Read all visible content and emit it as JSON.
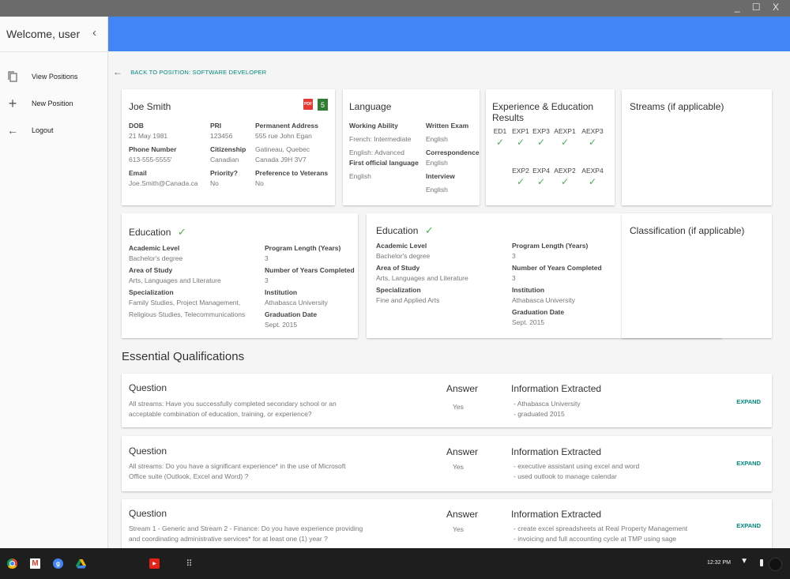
{
  "window": {
    "controls": "_ ☐ X"
  },
  "sidebar": {
    "welcome": "Welcome, user",
    "items": [
      {
        "label": "View Positions",
        "icon": "copy-icon"
      },
      {
        "label": "New Position",
        "icon": "plus-icon"
      },
      {
        "label": "Logout",
        "icon": "arrow-left-icon"
      }
    ]
  },
  "back_link": "BACK TO POSITION: SOFTWARE DEVELOPER",
  "candidate": {
    "name": "Joe Smith",
    "pdf_badge": "PDF",
    "score_badge": "5",
    "col1": [
      {
        "label": "DOB",
        "value": "21 May 1981"
      },
      {
        "label": "Phone Number",
        "value": "613-555-5555'"
      },
      {
        "label": "Email",
        "value": "Joe.Smith@Canada.ca"
      }
    ],
    "col2": [
      {
        "label": "PRI",
        "value": "123456"
      },
      {
        "label": "Citizenship",
        "value": "Canadian"
      },
      {
        "label": "Priority?",
        "value": "No"
      }
    ],
    "col3": {
      "address_label": "Permanent Address",
      "address_lines": [
        "555 rue John Egan",
        "Gatineau, Quebec",
        "Canada J9H 3V7"
      ],
      "veterans_label": "Preference to Veterans",
      "veterans_value": "No"
    }
  },
  "language": {
    "title": "Language",
    "working_label": "Working Ability",
    "french": "French: Intermediate",
    "english": "English: Advanced",
    "first_label": "First official language",
    "first_value": "English",
    "exam_label": "Written Exam",
    "exam_value": "English",
    "corr_label": "Correspondence",
    "corr_value": "English",
    "interview_label": "Interview",
    "interview_value": "English"
  },
  "experience": {
    "title": "Experience & Education Results",
    "row1": [
      "ED1",
      "EXP1",
      "EXP3",
      "AEXP1",
      "AEXP3"
    ],
    "row2": [
      "EXP2",
      "EXP4",
      "AEXP2",
      "AEXP4"
    ],
    "check": "✓"
  },
  "streams": {
    "title": "Streams (if applicable)"
  },
  "classification": {
    "title": "Classification (if applicable)"
  },
  "education": [
    {
      "title": "Education",
      "check": "✓",
      "left": [
        {
          "label": "Academic Level",
          "values": [
            "Bachelor's degree"
          ]
        },
        {
          "label": "Area of Study",
          "values": [
            "Arts, Languages and Literature"
          ]
        },
        {
          "label": "Specialization",
          "values": [
            "Family Studies, Project Management,",
            "Religious Studies, Telecommunications"
          ]
        }
      ],
      "right": [
        {
          "label": "Program Length (Years)",
          "values": [
            "3"
          ]
        },
        {
          "label": "Number of Years Completed",
          "values": [
            "3"
          ]
        },
        {
          "label": "Institution",
          "values": [
            "Athabasca University"
          ]
        },
        {
          "label": "Graduation Date",
          "values": [
            "Sept. 2015"
          ]
        }
      ]
    },
    {
      "title": "Education",
      "check": "✓",
      "left": [
        {
          "label": "Academic Level",
          "values": [
            "Bachelor's degree"
          ]
        },
        {
          "label": "Area of Study",
          "values": [
            "Arts, Languages and Literature"
          ]
        },
        {
          "label": "Specialization",
          "values": [
            "Fine and Applied Arts"
          ]
        }
      ],
      "right": [
        {
          "label": "Program Length (Years)",
          "values": [
            "3"
          ]
        },
        {
          "label": "Number of Years Completed",
          "values": [
            "3"
          ]
        },
        {
          "label": "Institution",
          "values": [
            "Athabasca University"
          ]
        },
        {
          "label": "Graduation Date",
          "values": [
            "Sept. 2015"
          ]
        }
      ]
    }
  ],
  "essential": {
    "title": "Essential Qualifications",
    "question_head": "Question",
    "answer_head": "Answer",
    "info_head": "Information Extracted",
    "expand_label": "EXPAND",
    "questions": [
      {
        "text": [
          "All streams: Have you successfully completed secondary school or an",
          "acceptable combination of education, training, or experience?"
        ],
        "answer": "Yes",
        "info": [
          "- Athabasca University",
          "- graduated 2015"
        ]
      },
      {
        "text": [
          "All streams: Do you have a significant experience* in the use of Microsoft",
          "Office suite (Outlook, Excel and Word) ?"
        ],
        "answer": "Yes",
        "info": [
          "- executive assistant using excel and word",
          "- used outlook to manage calendar"
        ]
      },
      {
        "text": [
          "Stream 1 - Generic and Stream 2 - Finance: Do you have experience providing",
          "and coordinating administrative services* for at least one (1) year ?"
        ],
        "answer": "Yes",
        "info": [
          "- create excel spreadsheets at Real Property Management",
          "- invoicing and full accounting cycle at TMP using sage"
        ]
      }
    ]
  },
  "taskbar": {
    "apps": [
      "chrome-icon",
      "gmail-icon",
      "google-plus-icon",
      "drive-icon",
      "youtube-icon",
      "app-launcher-icon"
    ],
    "clock": "12:32 PM"
  }
}
